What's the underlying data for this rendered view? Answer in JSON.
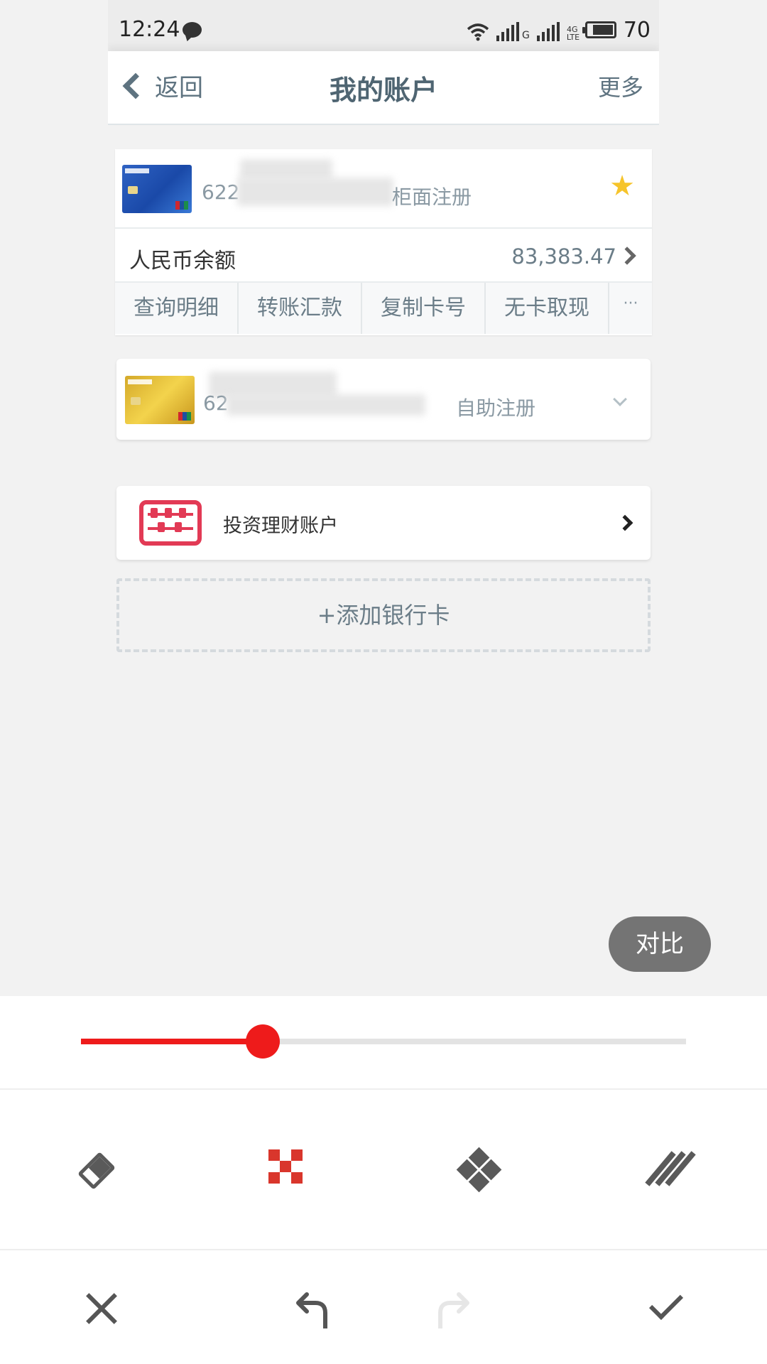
{
  "status_bar": {
    "time": "12:24",
    "network_g": "G",
    "network_4g": "4G LTE",
    "battery_level": "70"
  },
  "nav": {
    "back_label": "返回",
    "title": "我的账户",
    "more_label": "更多"
  },
  "accounts": [
    {
      "card_color": "blue",
      "number_prefix": "622",
      "registration": "柜面注册",
      "starred": true,
      "balance_label": "人民币余额",
      "balance_value": "83,383.47",
      "actions": [
        "查询明细",
        "转账汇款",
        "复制卡号",
        "无卡取现",
        "···"
      ]
    },
    {
      "card_color": "gold",
      "number_prefix": "62",
      "registration": "自助注册",
      "collapsed": true
    }
  ],
  "investment": {
    "icon": "abacus-icon",
    "label": "投资理财账户"
  },
  "add_card_label": "+添加银行卡",
  "editor": {
    "compare_label": "对比",
    "slider_value_percent": 30,
    "accent_color": "#ee1b1b",
    "tools": [
      "eraser-icon",
      "mosaic-icon",
      "diamond-mosaic-icon",
      "hatch-brush-icon"
    ],
    "selected_tool": "mosaic-icon",
    "bottom_actions": [
      "close-icon",
      "undo-icon",
      "redo-icon",
      "check-icon"
    ],
    "redo_enabled": false
  }
}
